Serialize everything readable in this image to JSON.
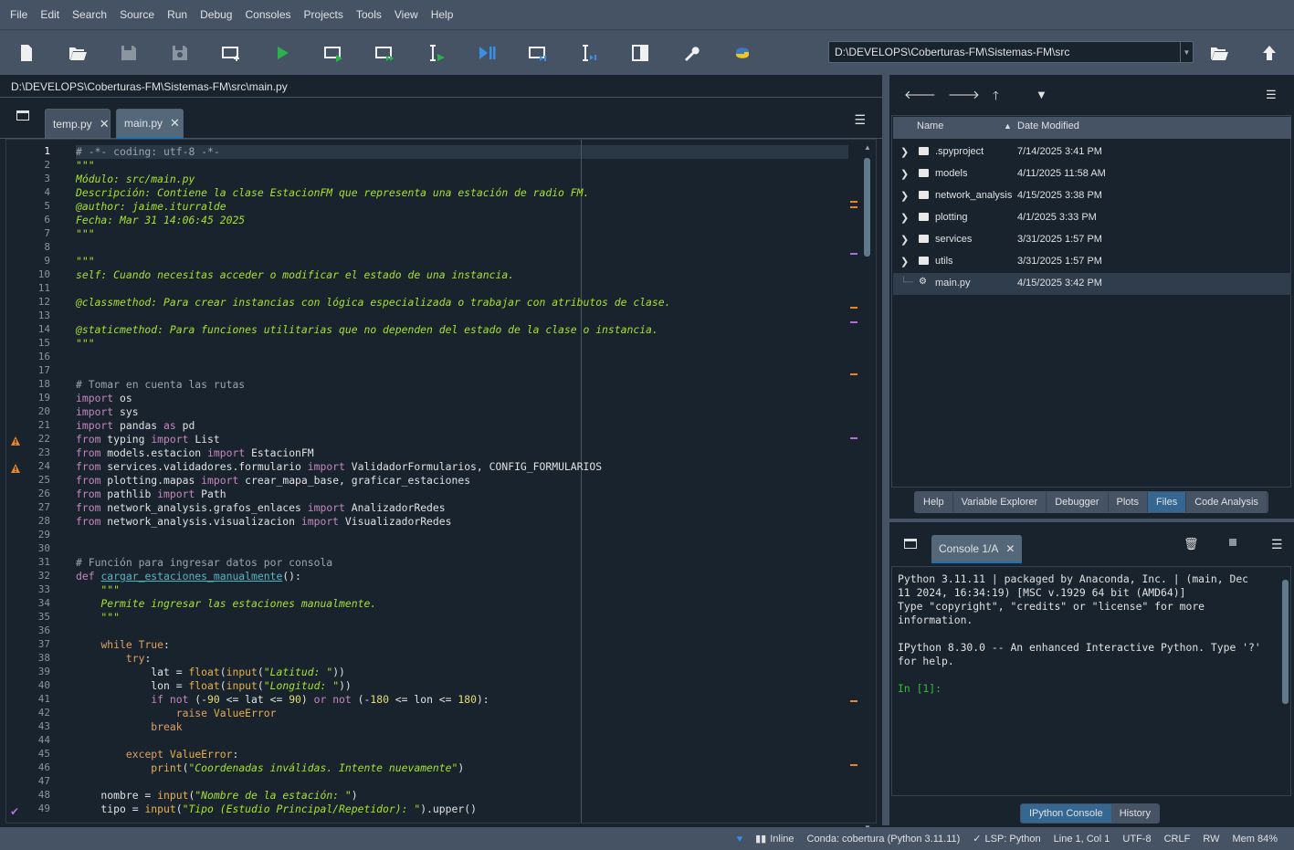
{
  "menu": [
    "File",
    "Edit",
    "Search",
    "Source",
    "Run",
    "Debug",
    "Consoles",
    "Projects",
    "Tools",
    "View",
    "Help"
  ],
  "toolbar": {
    "path": "D:\\DEVELOPS\\Coberturas-FM\\Sistemas-FM\\src"
  },
  "editor": {
    "file_path": "D:\\DEVELOPS\\Coberturas-FM\\Sistemas-FM\\src\\main.py",
    "tabs": [
      {
        "label": "temp.py"
      },
      {
        "label": "main.py"
      }
    ],
    "lines": [
      "# -*- coding: utf-8 -*-",
      "\"\"\"",
      "Módulo: src/main.py",
      "Descripción: Contiene la clase EstacionFM que representa una estación de radio FM.",
      "@author: jaime.iturralde",
      "Fecha: Mar 31 14:06:45 2025",
      "\"\"\"",
      "",
      "\"\"\"",
      "self: Cuando necesitas acceder o modificar el estado de una instancia.",
      "",
      "@classmethod: Para crear instancias con lógica especializada o trabajar con atributos de clase.",
      "",
      "@staticmethod: Para funciones utilitarias que no dependen del estado de la clase o instancia.",
      "\"\"\"",
      "",
      "",
      "# Tomar en cuenta las rutas",
      "import os",
      "import sys",
      "import pandas as pd",
      "from typing import List",
      "from models.estacion import EstacionFM",
      "from services.validadores.formulario import ValidadorFormularios, CONFIG_FORMULARIOS",
      "from plotting.mapas import crear_mapa_base, graficar_estaciones",
      "from pathlib import Path",
      "from network_analysis.grafos_enlaces import AnalizadorRedes",
      "from network_analysis.visualizacion import VisualizadorRedes",
      "",
      "",
      "# Función para ingresar datos por consola",
      "def cargar_estaciones_manualmente():",
      "    \"\"\"",
      "    Permite ingresar las estaciones manualmente.",
      "    \"\"\"",
      "",
      "    while True:",
      "        try:",
      "            lat = float(input(\"Latitud: \"))",
      "            lon = float(input(\"Longitud: \"))",
      "            if not (-90 <= lat <= 90) or not (-180 <= lon <= 180):",
      "                raise ValueError",
      "            break",
      "",
      "        except ValueError:",
      "            print(\"Coordenadas inválidas. Intente nuevamente\")",
      "",
      "    nombre = input(\"Nombre de la estación: \")",
      "    tipo = input(\"Tipo (Estudio Principal/Repetidor): \").upper()"
    ]
  },
  "files": {
    "headers": {
      "name": "Name",
      "date": "Date Modified"
    },
    "rows": [
      {
        "name": ".spyproject",
        "date": "7/14/2025 3:41 PM",
        "type": "folder"
      },
      {
        "name": "models",
        "date": "4/11/2025 11:58 AM",
        "type": "folder"
      },
      {
        "name": "network_analysis",
        "date": "4/15/2025 3:38 PM",
        "type": "folder"
      },
      {
        "name": "plotting",
        "date": "4/1/2025 3:33 PM",
        "type": "folder"
      },
      {
        "name": "services",
        "date": "3/31/2025 1:57 PM",
        "type": "folder"
      },
      {
        "name": "utils",
        "date": "3/31/2025 1:57 PM",
        "type": "folder"
      },
      {
        "name": "main.py",
        "date": "4/15/2025 3:42 PM",
        "type": "python"
      }
    ],
    "pane_tabs": [
      "Help",
      "Variable Explorer",
      "Debugger",
      "Plots",
      "Files",
      "Code Analysis"
    ],
    "active_tab": "Files"
  },
  "console": {
    "tab": "Console 1/A",
    "lines": [
      "Python 3.11.11 | packaged by Anaconda, Inc. | (main, Dec",
      "11 2024, 16:34:19) [MSC v.1929 64 bit (AMD64)]",
      "Type \"copyright\", \"credits\" or \"license\" for more",
      "information.",
      "",
      "IPython 8.30.0 -- An enhanced Interactive Python. Type '?'",
      "for help.",
      ""
    ],
    "prompt": "In [1]:",
    "pane_tabs": [
      "IPython Console",
      "History"
    ]
  },
  "status": {
    "inline": "Inline",
    "conda": "Conda: cobertura (Python 3.11.11)",
    "lsp": "LSP: Python",
    "position": "Line 1, Col 1",
    "encoding": "UTF-8",
    "eol": "CRLF",
    "mode": "RW",
    "mem": "Mem 84%"
  }
}
